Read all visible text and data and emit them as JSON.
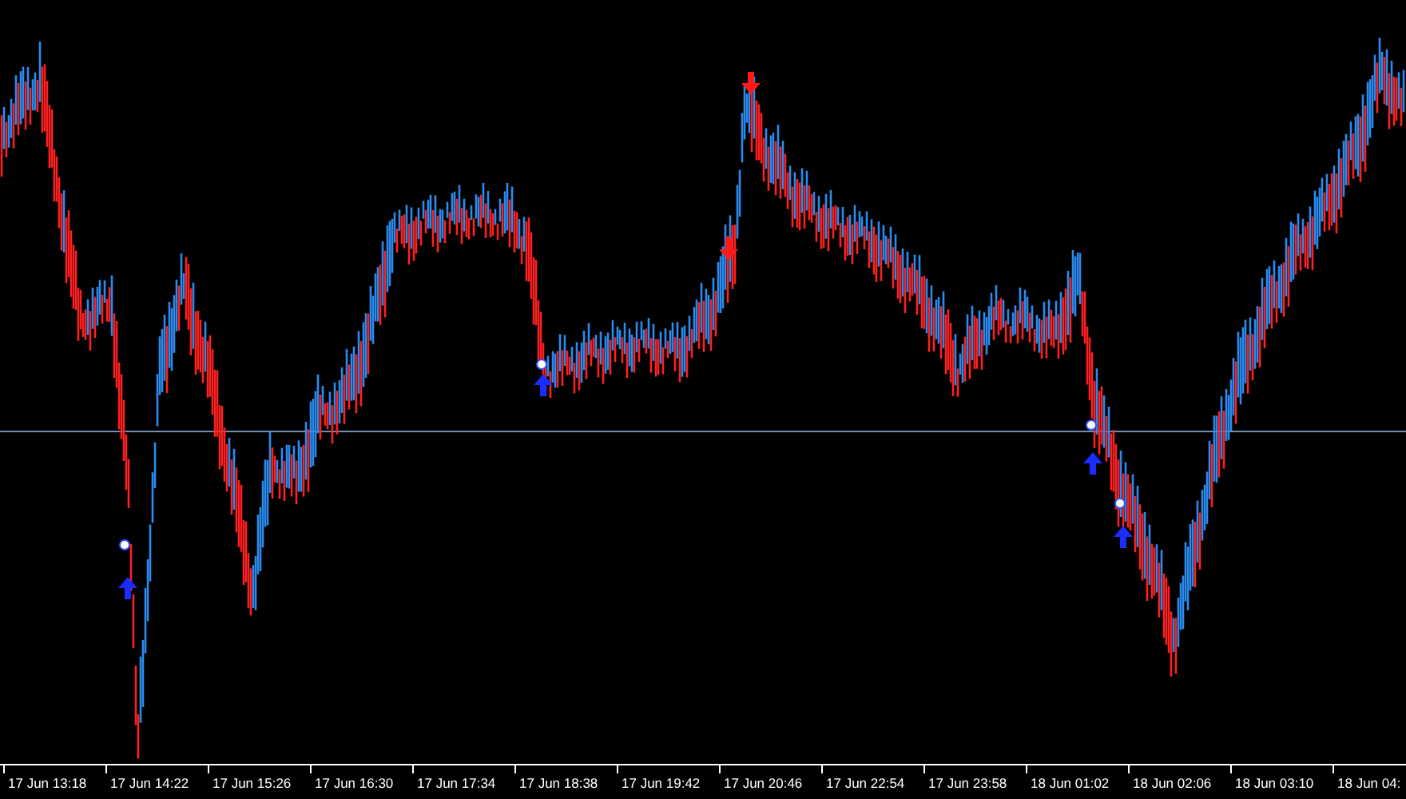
{
  "x_axis": {
    "labels": [
      "17 Jun 13:18",
      "17 Jun 14:22",
      "17 Jun 15:26",
      "17 Jun 16:30",
      "17 Jun 17:34",
      "17 Jun 18:38",
      "17 Jun 19:42",
      "17 Jun 20:46",
      "17 Jun 22:54",
      "17 Jun 23:58",
      "18 Jun 01:02",
      "18 Jun 02:06",
      "18 Jun 03:10",
      "18 Jun 04:"
    ]
  }
}
